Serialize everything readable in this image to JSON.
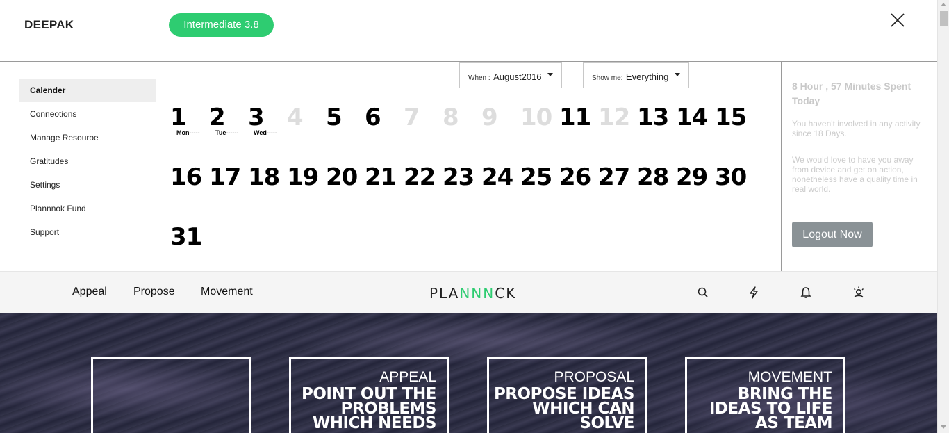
{
  "header": {
    "user_name": "DEEPAK",
    "level_badge": "Intermediate 3.8"
  },
  "sidebar": {
    "items": [
      {
        "label": "Calender",
        "active": true
      },
      {
        "label": "Conneotions",
        "active": false
      },
      {
        "label": "Manage Resouroe",
        "active": false
      },
      {
        "label": "Gratitudes",
        "active": false
      },
      {
        "label": "Settings",
        "active": false
      },
      {
        "label": "Plannnok Fund",
        "active": false
      },
      {
        "label": "Support",
        "active": false
      }
    ]
  },
  "calendar": {
    "when_label": "When :",
    "when_value": "August2016",
    "show_label": "Show me:",
    "show_value": "Everything",
    "days": [
      {
        "n": "1",
        "dim": false
      },
      {
        "n": "2",
        "dim": false
      },
      {
        "n": "3",
        "dim": false
      },
      {
        "n": "4",
        "dim": true
      },
      {
        "n": "5",
        "dim": false
      },
      {
        "n": "6",
        "dim": false
      },
      {
        "n": "7",
        "dim": true
      },
      {
        "n": "8",
        "dim": true
      },
      {
        "n": "9",
        "dim": true
      },
      {
        "n": "10",
        "dim": true
      },
      {
        "n": "11",
        "dim": false
      },
      {
        "n": "12",
        "dim": true
      },
      {
        "n": "13",
        "dim": false
      },
      {
        "n": "14",
        "dim": false
      },
      {
        "n": "15",
        "dim": false
      },
      {
        "n": "16",
        "dim": false
      },
      {
        "n": "17",
        "dim": false
      },
      {
        "n": "18",
        "dim": false
      },
      {
        "n": "19",
        "dim": false
      },
      {
        "n": "20",
        "dim": false
      },
      {
        "n": "21",
        "dim": false
      },
      {
        "n": "22",
        "dim": false
      },
      {
        "n": "23",
        "dim": false
      },
      {
        "n": "24",
        "dim": false
      },
      {
        "n": "25",
        "dim": false
      },
      {
        "n": "26",
        "dim": false
      },
      {
        "n": "27",
        "dim": false
      },
      {
        "n": "28",
        "dim": false
      },
      {
        "n": "29",
        "dim": false
      },
      {
        "n": "30",
        "dim": false
      },
      {
        "n": "31",
        "dim": false
      }
    ],
    "day_labels": [
      "Mon-----",
      "Tue------",
      "Wed-----"
    ]
  },
  "stats": {
    "time_spent": "8 Hour , 57 Minutes Spent Today",
    "inactivity": "You haven't involved in any activity since 18 Days.",
    "message": "We would love to have you away from device and get on action, nonetheless have a quality time in real world.",
    "logout_label": "Logout Now"
  },
  "nav": {
    "links": [
      "Appeal",
      "Propose",
      "Movement"
    ],
    "logo_prefix": "PLA",
    "logo_accent": "NNN",
    "logo_suffix": "CK",
    "icons": [
      "search-icon",
      "lightning-icon",
      "bell-icon",
      "user-icon"
    ],
    "accent_color": "#2ecc71"
  },
  "hero": {
    "cards": [
      {
        "title": "",
        "desc": ""
      },
      {
        "title": "APPEAL",
        "desc": "POINT OUT THE PROBLEMS WHICH NEEDS"
      },
      {
        "title": "PROPOSAL",
        "desc": "PROPOSE IDEAS WHICH CAN SOLVE"
      },
      {
        "title": "MOVEMENT",
        "desc": "BRING THE IDEAS TO LIFE AS TEAM"
      }
    ]
  }
}
